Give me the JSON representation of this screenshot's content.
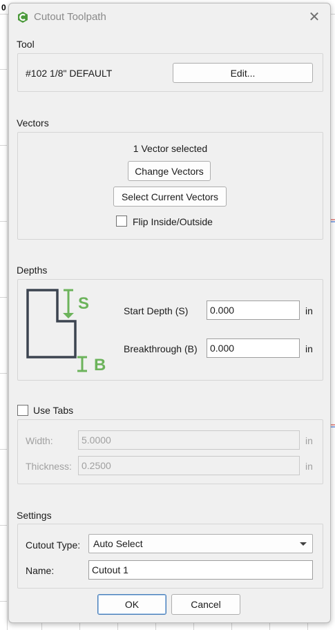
{
  "background": {
    "zero_label": "0"
  },
  "dialog": {
    "title": "Cutout Toolpath",
    "accent_color": "#6cb35b",
    "tool": {
      "section": "Tool",
      "name": "#102 1/8\" DEFAULT",
      "edit_label": "Edit..."
    },
    "vectors": {
      "section": "Vectors",
      "status": "1 Vector selected",
      "change_label": "Change Vectors",
      "select_current_label": "Select Current Vectors",
      "flip_label": "Flip Inside/Outside",
      "flip_checked": false
    },
    "depths": {
      "section": "Depths",
      "diagram_start_letter": "S",
      "diagram_break_letter": "B",
      "start_label": "Start Depth (S)",
      "start_value": "0.000",
      "start_unit": "in",
      "break_label": "Breakthrough (B)",
      "break_value": "0.000",
      "break_unit": "in"
    },
    "tabs": {
      "use_tabs_label": "Use Tabs",
      "use_tabs_checked": false,
      "width_label": "Width:",
      "width_value": "5.0000",
      "width_unit": "in",
      "thickness_label": "Thickness:",
      "thickness_value": "0.2500",
      "thickness_unit": "in"
    },
    "settings": {
      "section": "Settings",
      "cutout_type_label": "Cutout Type:",
      "cutout_type_value": "Auto Select",
      "name_label": "Name:",
      "name_value": "Cutout 1"
    },
    "footer": {
      "ok_label": "OK",
      "cancel_label": "Cancel"
    }
  }
}
